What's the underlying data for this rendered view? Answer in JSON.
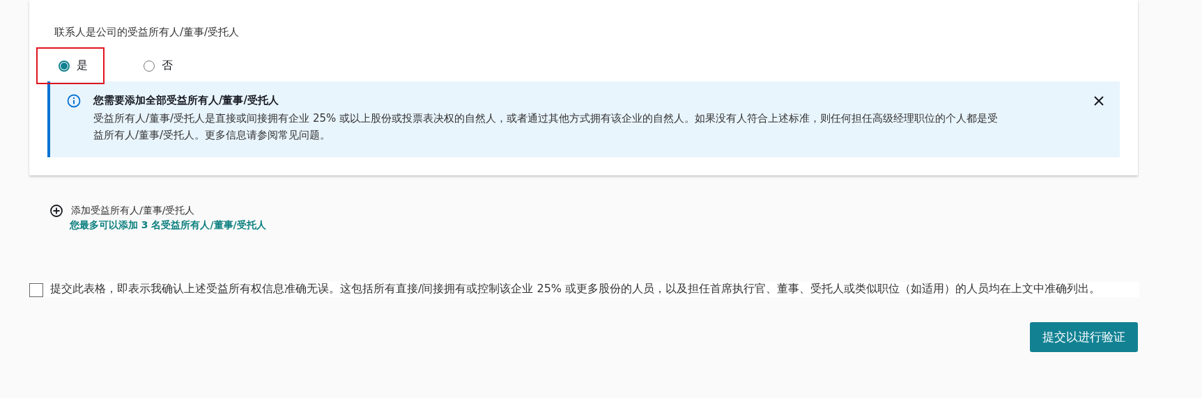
{
  "question": {
    "label": "联系人是公司的受益所有人/董事/受托人",
    "options": [
      {
        "label": "是",
        "selected": true,
        "highlighted": true
      },
      {
        "label": "否",
        "selected": false,
        "highlighted": false
      }
    ]
  },
  "alert": {
    "title": "您需要添加全部受益所有人/董事/受托人",
    "body": "受益所有人/董事/受托人是直接或间接拥有企业 25% 或以上股份或投票表决权的自然人，或者通过其他方式拥有该企业的自然人。如果没有人符合上述标准，则任何担任高级经理职位的个人都是受益所有人/董事/受托人。更多信息请参阅常见问题。"
  },
  "add": {
    "label": "添加受益所有人/董事/受托人",
    "hint": "您最多可以添加 3 名受益所有人/董事/受托人"
  },
  "confirm": {
    "checked": false,
    "text": "提交此表格，即表示我确认上述受益所有权信息准确无误。这包括所有直接/间接拥有或控制该企业 25% 或更多股份的人员，以及担任首席执行官、董事、受托人或类似职位（如适用）的人员均在上文中准确列出。"
  },
  "submit": {
    "label": "提交以进行验证"
  }
}
